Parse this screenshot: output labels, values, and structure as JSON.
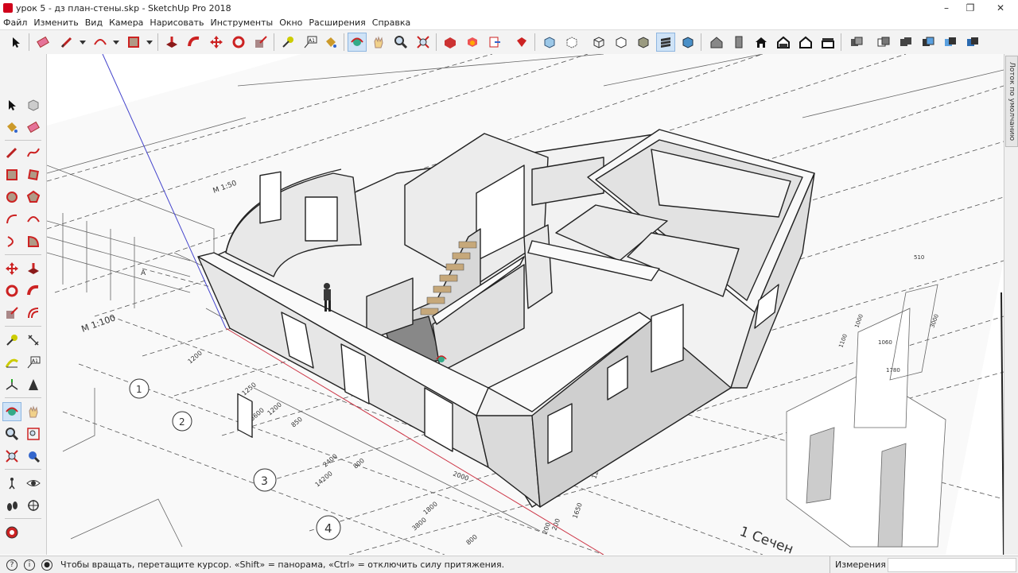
{
  "window": {
    "title": "урок 5 - дз план-стены.skp - SketchUp Pro 2018",
    "controls": [
      "–",
      "❐",
      "✕"
    ]
  },
  "menu": [
    "Файл",
    "Изменить",
    "Вид",
    "Камера",
    "Нарисовать",
    "Инструменты",
    "Окно",
    "Расширения",
    "Справка"
  ],
  "right_panel": {
    "tray_label": "Лоток по умолчанию"
  },
  "status": {
    "message": "Чтобы вращать, перетащите курсор. «Shift» = панорама, «Ctrl» = отключить силу притяжения.",
    "measure_label": "Измерения",
    "measure_value": ""
  },
  "drawing": {
    "scale_label": "М 1:100",
    "scale_label_2": "М 1:50",
    "section_label": "1 Сечен",
    "axis_numbers": [
      "1",
      "2",
      "3",
      "4"
    ],
    "dimensions": [
      "1200",
      "1250",
      "3600",
      "850",
      "1200",
      "2400",
      "800",
      "14200",
      "1800",
      "3800",
      "800",
      "1200",
      "900",
      "600",
      "1200",
      "1650",
      "200",
      "200",
      "1200",
      "1200",
      "3000",
      "1000",
      "1100",
      "1060",
      "1780",
      "510",
      "2000"
    ],
    "axis_label": "А"
  },
  "colors": {
    "toolbar_bg": "#f3f3f3",
    "active_bg": "#cfe3f7",
    "wall_top": "#f6f6f6",
    "wall_side": "#d9d9d9",
    "plan_line": "#555555"
  }
}
